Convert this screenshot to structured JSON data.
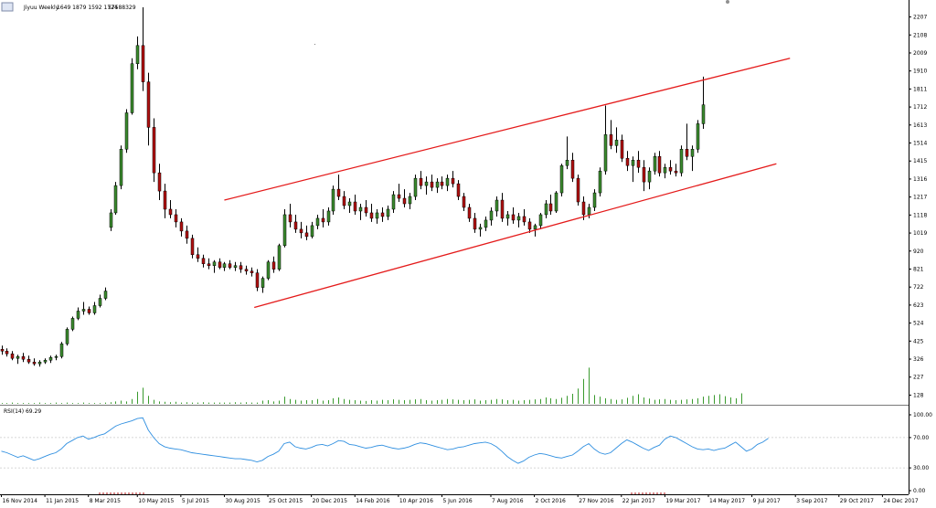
{
  "header": {
    "symbol": "Jiyuu Weekly",
    "ohlc": "1649 1879 1592 1724",
    "volume": "57588329"
  },
  "rsi_header": "RSI(14) 69.29",
  "colors": {
    "bull": "#3a8a2e",
    "bear": "#b01010",
    "channel": "#e41a1a",
    "rsi_line": "#2f8fe0",
    "volume": "#3a9a2e",
    "grid": "#c8c8c8",
    "axis": "#000000"
  },
  "chart_data": [
    {
      "type": "candlestick",
      "title": "",
      "xlabel": "",
      "ylabel": "",
      "ylim": [
        80,
        2260
      ],
      "y_ticks": [
        "2207",
        "2108",
        "2009",
        "1910",
        "1811",
        "1712",
        "1613",
        "1514",
        "1415",
        "1316",
        "1217",
        "1118",
        "1019",
        "920",
        "821",
        "722",
        "623",
        "524",
        "425",
        "326",
        "227",
        "128"
      ],
      "x_ticks": [
        "16 Nov 2014",
        "11 Jan 2015",
        "8 Mar 2015",
        "10 May 2015",
        "5 Jul 2015",
        "30 Aug 2015",
        "25 Oct 2015",
        "20 Dec 2015",
        "14 Feb 2016",
        "10 Apr 2016",
        "5 Jun 2016",
        "7 Aug 2016",
        "2 Oct 2016",
        "27 Nov 2016",
        "22 Jan 2017",
        "19 Mar 2017",
        "14 May 2017",
        "9 Jul 2017",
        "3 Sep 2017",
        "29 Oct 2017",
        "24 Dec 2017"
      ],
      "x_tick_index": [
        0,
        8,
        16,
        25,
        33,
        41,
        49,
        57,
        65,
        73,
        81,
        90,
        98,
        106,
        114,
        122,
        130,
        138,
        146,
        154,
        162
      ],
      "candles": [
        [
          380,
          400,
          350,
          370
        ],
        [
          370,
          385,
          340,
          355
        ],
        [
          355,
          370,
          320,
          330
        ],
        [
          330,
          350,
          300,
          340
        ],
        [
          340,
          360,
          310,
          325
        ],
        [
          325,
          345,
          300,
          310
        ],
        [
          310,
          330,
          290,
          300
        ],
        [
          300,
          320,
          285,
          310
        ],
        [
          310,
          330,
          300,
          320
        ],
        [
          320,
          345,
          305,
          335
        ],
        [
          335,
          350,
          320,
          340
        ],
        [
          340,
          420,
          330,
          410
        ],
        [
          410,
          500,
          400,
          490
        ],
        [
          490,
          560,
          480,
          550
        ],
        [
          550,
          610,
          540,
          590
        ],
        [
          590,
          640,
          570,
          600
        ],
        [
          600,
          615,
          570,
          580
        ],
        [
          580,
          640,
          570,
          620
        ],
        [
          620,
          680,
          610,
          660
        ],
        [
          660,
          720,
          650,
          700
        ],
        [
          1050,
          1150,
          1030,
          1130
        ],
        [
          1130,
          1300,
          1120,
          1280
        ],
        [
          1280,
          1500,
          1260,
          1480
        ],
        [
          1480,
          1700,
          1460,
          1680
        ],
        [
          1680,
          1980,
          1670,
          1950
        ],
        [
          1950,
          2100,
          1920,
          2050
        ],
        [
          2050,
          2260,
          1800,
          1850
        ],
        [
          1850,
          1900,
          1500,
          1600
        ],
        [
          1600,
          1650,
          1300,
          1350
        ],
        [
          1350,
          1400,
          1200,
          1250
        ],
        [
          1250,
          1290,
          1100,
          1150
        ],
        [
          1150,
          1200,
          1100,
          1120
        ],
        [
          1120,
          1150,
          1050,
          1080
        ],
        [
          1080,
          1100,
          1000,
          1030
        ],
        [
          1030,
          1060,
          960,
          990
        ],
        [
          990,
          1010,
          880,
          900
        ],
        [
          900,
          940,
          860,
          880
        ],
        [
          880,
          900,
          830,
          850
        ],
        [
          850,
          880,
          820,
          840
        ],
        [
          840,
          870,
          800,
          860
        ],
        [
          860,
          880,
          820,
          830
        ],
        [
          830,
          860,
          810,
          850
        ],
        [
          850,
          870,
          820,
          830
        ],
        [
          830,
          860,
          810,
          840
        ],
        [
          840,
          860,
          800,
          820
        ],
        [
          820,
          840,
          790,
          810
        ],
        [
          810,
          830,
          780,
          800
        ],
        [
          800,
          820,
          700,
          720
        ],
        [
          720,
          780,
          690,
          770
        ],
        [
          770,
          870,
          760,
          860
        ],
        [
          860,
          890,
          800,
          820
        ],
        [
          820,
          960,
          810,
          950
        ],
        [
          950,
          1150,
          940,
          1120
        ],
        [
          1120,
          1180,
          1050,
          1080
        ],
        [
          1080,
          1120,
          1020,
          1040
        ],
        [
          1040,
          1080,
          990,
          1020
        ],
        [
          1020,
          1060,
          980,
          1000
        ],
        [
          1000,
          1080,
          990,
          1060
        ],
        [
          1060,
          1120,
          1040,
          1100
        ],
        [
          1100,
          1150,
          1050,
          1080
        ],
        [
          1080,
          1160,
          1060,
          1140
        ],
        [
          1140,
          1280,
          1120,
          1260
        ],
        [
          1260,
          1340,
          1200,
          1220
        ],
        [
          1220,
          1250,
          1150,
          1170
        ],
        [
          1170,
          1210,
          1130,
          1190
        ],
        [
          1190,
          1230,
          1120,
          1140
        ],
        [
          1140,
          1180,
          1090,
          1160
        ],
        [
          1160,
          1200,
          1110,
          1130
        ],
        [
          1130,
          1180,
          1080,
          1100
        ],
        [
          1100,
          1150,
          1070,
          1130
        ],
        [
          1130,
          1160,
          1080,
          1110
        ],
        [
          1110,
          1170,
          1090,
          1150
        ],
        [
          1150,
          1250,
          1130,
          1230
        ],
        [
          1230,
          1290,
          1190,
          1210
        ],
        [
          1210,
          1260,
          1160,
          1180
        ],
        [
          1180,
          1240,
          1150,
          1220
        ],
        [
          1220,
          1340,
          1200,
          1320
        ],
        [
          1320,
          1360,
          1260,
          1280
        ],
        [
          1280,
          1330,
          1230,
          1300
        ],
        [
          1300,
          1340,
          1250,
          1270
        ],
        [
          1270,
          1320,
          1240,
          1300
        ],
        [
          1300,
          1330,
          1260,
          1280
        ],
        [
          1280,
          1340,
          1250,
          1320
        ],
        [
          1320,
          1360,
          1270,
          1290
        ],
        [
          1290,
          1310,
          1200,
          1220
        ],
        [
          1220,
          1240,
          1140,
          1160
        ],
        [
          1160,
          1180,
          1080,
          1100
        ],
        [
          1100,
          1130,
          1020,
          1040
        ],
        [
          1040,
          1070,
          1000,
          1050
        ],
        [
          1050,
          1110,
          1030,
          1090
        ],
        [
          1090,
          1160,
          1060,
          1140
        ],
        [
          1140,
          1220,
          1110,
          1200
        ],
        [
          1200,
          1240,
          1080,
          1100
        ],
        [
          1100,
          1140,
          1060,
          1120
        ],
        [
          1120,
          1160,
          1070,
          1090
        ],
        [
          1090,
          1130,
          1050,
          1110
        ],
        [
          1110,
          1150,
          1060,
          1080
        ],
        [
          1080,
          1100,
          1020,
          1040
        ],
        [
          1040,
          1070,
          1000,
          1060
        ],
        [
          1060,
          1130,
          1040,
          1120
        ],
        [
          1120,
          1200,
          1100,
          1180
        ],
        [
          1180,
          1230,
          1120,
          1140
        ],
        [
          1140,
          1250,
          1130,
          1240
        ],
        [
          1240,
          1400,
          1220,
          1390
        ],
        [
          1390,
          1550,
          1370,
          1420
        ],
        [
          1420,
          1460,
          1300,
          1320
        ],
        [
          1320,
          1340,
          1170,
          1190
        ],
        [
          1190,
          1220,
          1090,
          1120
        ],
        [
          1120,
          1180,
          1100,
          1160
        ],
        [
          1160,
          1260,
          1140,
          1240
        ],
        [
          1240,
          1380,
          1220,
          1360
        ],
        [
          1360,
          1720,
          1340,
          1560
        ],
        [
          1560,
          1640,
          1480,
          1500
        ],
        [
          1500,
          1600,
          1460,
          1530
        ],
        [
          1530,
          1560,
          1410,
          1430
        ],
        [
          1430,
          1470,
          1360,
          1390
        ],
        [
          1390,
          1440,
          1300,
          1420
        ],
        [
          1420,
          1470,
          1350,
          1380
        ],
        [
          1380,
          1420,
          1250,
          1300
        ],
        [
          1300,
          1380,
          1260,
          1360
        ],
        [
          1360,
          1460,
          1340,
          1440
        ],
        [
          1440,
          1470,
          1330,
          1350
        ],
        [
          1350,
          1400,
          1320,
          1380
        ],
        [
          1380,
          1420,
          1340,
          1360
        ],
        [
          1360,
          1400,
          1330,
          1350
        ],
        [
          1350,
          1500,
          1330,
          1480
        ],
        [
          1480,
          1620,
          1420,
          1440
        ],
        [
          1440,
          1500,
          1360,
          1480
        ],
        [
          1480,
          1640,
          1460,
          1620
        ],
        [
          1620,
          1879,
          1592,
          1724
        ]
      ]
    },
    {
      "type": "bar",
      "title": "",
      "values": [
        2,
        2,
        3,
        2,
        2,
        2,
        2,
        3,
        2,
        2,
        3,
        2,
        3,
        2,
        2,
        3,
        2,
        2,
        2,
        3,
        4,
        6,
        8,
        6,
        12,
        30,
        40,
        20,
        10,
        6,
        5,
        4,
        5,
        3,
        4,
        3,
        3,
        4,
        3,
        3,
        3,
        3,
        3,
        4,
        3,
        4,
        3,
        3,
        8,
        9,
        6,
        8,
        18,
        12,
        10,
        8,
        9,
        9,
        12,
        8,
        9,
        14,
        16,
        12,
        10,
        9,
        8,
        7,
        9,
        8,
        10,
        9,
        11,
        10,
        9,
        10,
        11,
        12,
        9,
        8,
        9,
        10,
        12,
        11,
        10,
        9,
        10,
        11,
        8,
        9,
        10,
        12,
        11,
        9,
        10,
        8,
        9,
        10,
        11,
        12,
        16,
        14,
        12,
        15,
        20,
        25,
        38,
        62,
        90,
        22,
        18,
        14,
        12,
        10,
        11,
        15,
        20,
        24,
        16,
        13,
        10,
        11,
        12,
        10,
        9,
        10,
        11,
        12,
        14,
        18,
        20,
        22,
        24,
        19,
        16,
        14,
        26
      ],
      "ylim": [
        0,
        100
      ]
    },
    {
      "type": "line",
      "title": "",
      "series_label": "RSI(14) 69.29",
      "y_ticks": [
        "100.00",
        "70.00",
        "30.00",
        "0.00"
      ],
      "ylim": [
        0,
        100
      ],
      "levels": [
        70,
        30
      ],
      "values": [
        52,
        50,
        47,
        44,
        46,
        43,
        40,
        42,
        45,
        48,
        50,
        55,
        62,
        66,
        70,
        72,
        68,
        70,
        73,
        75,
        80,
        85,
        88,
        90,
        92,
        95,
        96,
        80,
        70,
        62,
        58,
        56,
        55,
        54,
        52,
        50,
        49,
        48,
        47,
        46,
        45,
        44,
        43,
        42,
        42,
        41,
        40,
        38,
        40,
        45,
        48,
        52,
        62,
        64,
        58,
        56,
        55,
        57,
        60,
        61,
        59,
        62,
        66,
        65,
        61,
        60,
        58,
        56,
        57,
        59,
        60,
        58,
        56,
        55,
        56,
        58,
        61,
        63,
        62,
        60,
        58,
        56,
        54,
        55,
        57,
        58,
        60,
        62,
        63,
        64,
        62,
        58,
        52,
        45,
        40,
        36,
        39,
        44,
        47,
        49,
        48,
        46,
        44,
        43,
        45,
        47,
        52,
        58,
        62,
        55,
        50,
        48,
        50,
        56,
        62,
        67,
        64,
        60,
        56,
        53,
        57,
        60,
        68,
        72,
        70,
        66,
        62,
        58,
        55,
        54,
        55,
        53,
        55,
        56,
        60,
        64,
        58,
        52,
        55,
        61,
        64,
        69
      ]
    }
  ]
}
